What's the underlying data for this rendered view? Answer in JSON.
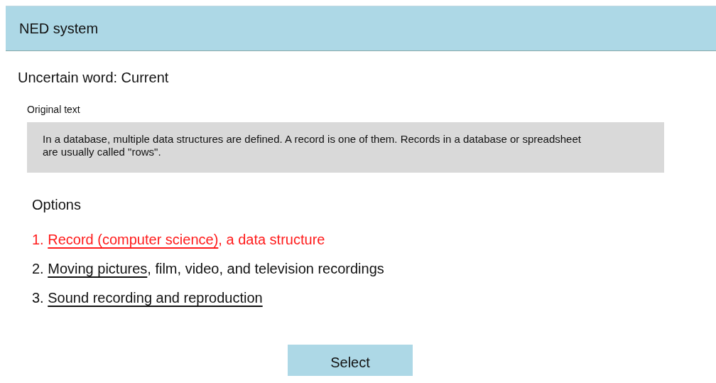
{
  "header": {
    "title": "NED system"
  },
  "uncertain_word": "Uncertain word: Current",
  "original_text": {
    "label": "Original text",
    "text": "In a database, multiple data structures are defined. A record is one of them. Records in a database or spreadsheet are usually called \"rows\"."
  },
  "options": {
    "heading": "Options",
    "items": [
      {
        "number": "1.",
        "link": "Record (computer science)",
        "rest": ", a data structure",
        "selected": true
      },
      {
        "number": "2.",
        "link": "Moving pictures",
        "rest": ", film, video, and television recordings",
        "selected": false
      },
      {
        "number": "3.",
        "link": "Sound recording and reproduction",
        "selected": false
      }
    ]
  },
  "button": "Select"
}
